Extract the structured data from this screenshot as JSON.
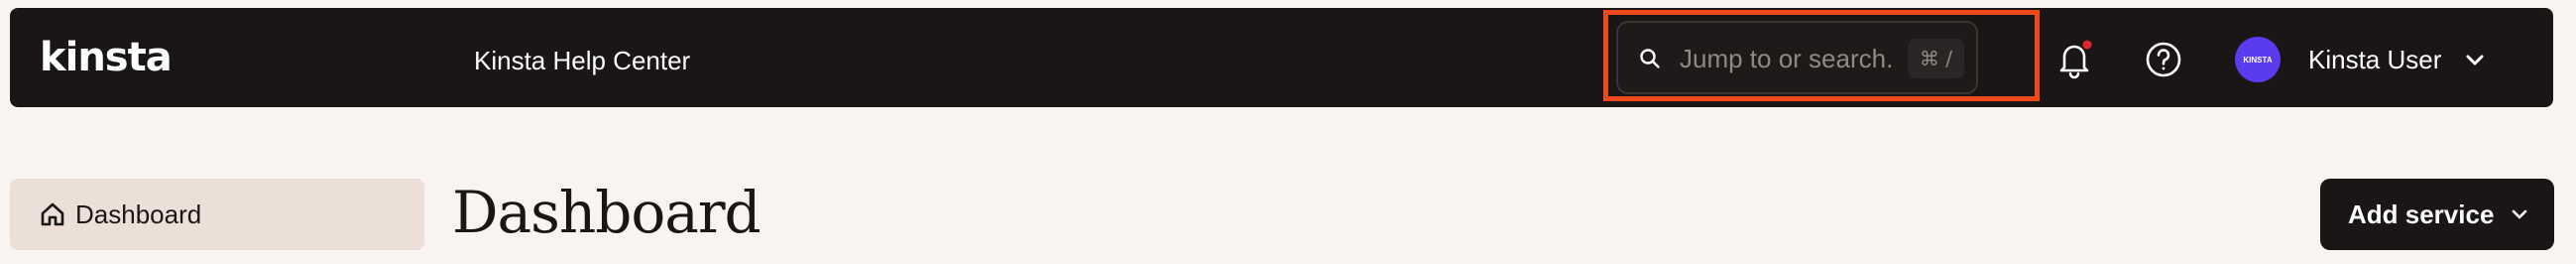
{
  "topbar": {
    "logo_text": "kinsta",
    "help_center_label": "Kinsta Help Center",
    "search": {
      "placeholder": "Jump to or search...",
      "shortcut": "⌘ /"
    },
    "icons": {
      "search": "search-icon",
      "bell": "bell-icon",
      "help": "question-circle-icon",
      "chevron": "chevron-down-icon"
    },
    "notification_dot_color": "#e0262b",
    "user": {
      "avatar_text": "KINSTA",
      "name": "Kinsta User"
    }
  },
  "sidebar": {
    "active_item": {
      "label": "Dashboard",
      "icon": "home-icon"
    }
  },
  "main": {
    "title": "Dashboard",
    "add_service_label": "Add service"
  },
  "colors": {
    "topbar_bg": "#1a1615",
    "page_bg": "#f8f4f1",
    "highlight": "#ee4a1a",
    "avatar": "#5b3bf0",
    "sidebar_active_bg": "#ecdfd8"
  }
}
